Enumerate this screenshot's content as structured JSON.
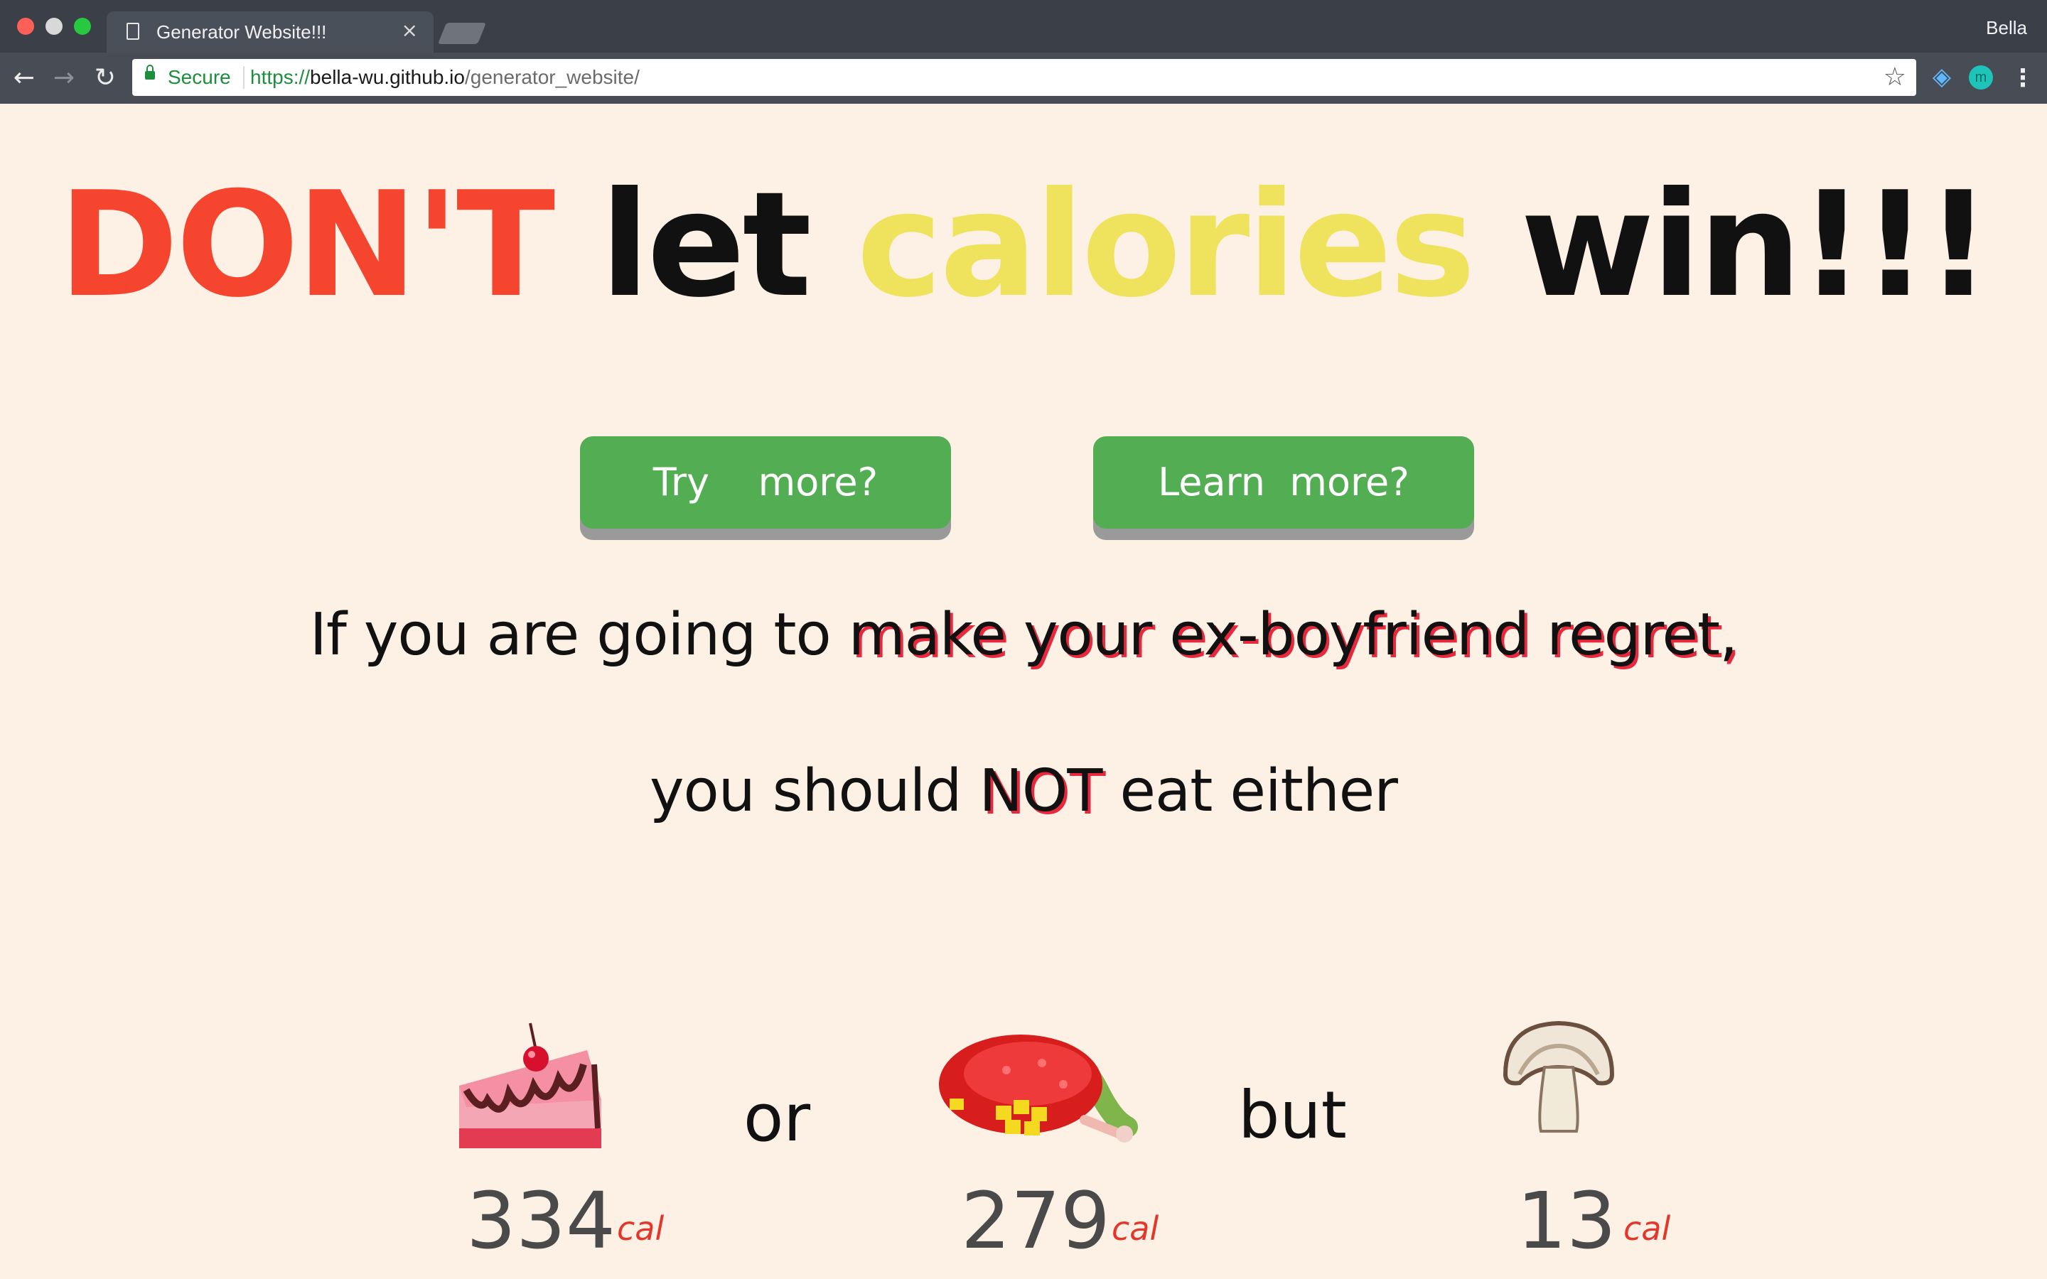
{
  "browser": {
    "tab_title": "Generator Website!!!",
    "tab_close": "×",
    "profile_name": "Bella",
    "secure_label": "Secure",
    "url_scheme": "https://",
    "url_host": "bella-wu.github.io",
    "url_path": "/generator_website/",
    "icons": [
      "document-icon",
      "close-icon",
      "back-arrow-icon",
      "forward-arrow-icon",
      "reload-icon",
      "lock-icon",
      "star-icon",
      "gem-extension-icon",
      "m-extension-icon",
      "menu-icon"
    ]
  },
  "headline": {
    "word1": "DON'T",
    "word2": "let",
    "word3": "calories",
    "word4": "win!!!",
    "colors": {
      "word1": "#f5452e",
      "word2": "#111111",
      "word3": "#efe35e",
      "word4": "#111111"
    }
  },
  "buttons": {
    "try_label": "Try    more?",
    "learn_label": "Learn  more?",
    "color": "#53ae53"
  },
  "message": {
    "line1_prefix": "If you are going to ",
    "line1_highlight": "make your ex-boyfriend regret,",
    "line2_prefix": "you should ",
    "line2_highlight": "NOT",
    "line2_suffix": " eat either"
  },
  "foods": [
    {
      "icon": "cheesecake-icon",
      "calories": "334",
      "unit": "cal"
    },
    {
      "icon": "meat-dish-icon",
      "calories": "279",
      "unit": "cal"
    },
    {
      "icon": "mushroom-icon",
      "calories": "13",
      "unit": "cal"
    }
  ],
  "connectors": {
    "or": "or",
    "but": "but"
  }
}
